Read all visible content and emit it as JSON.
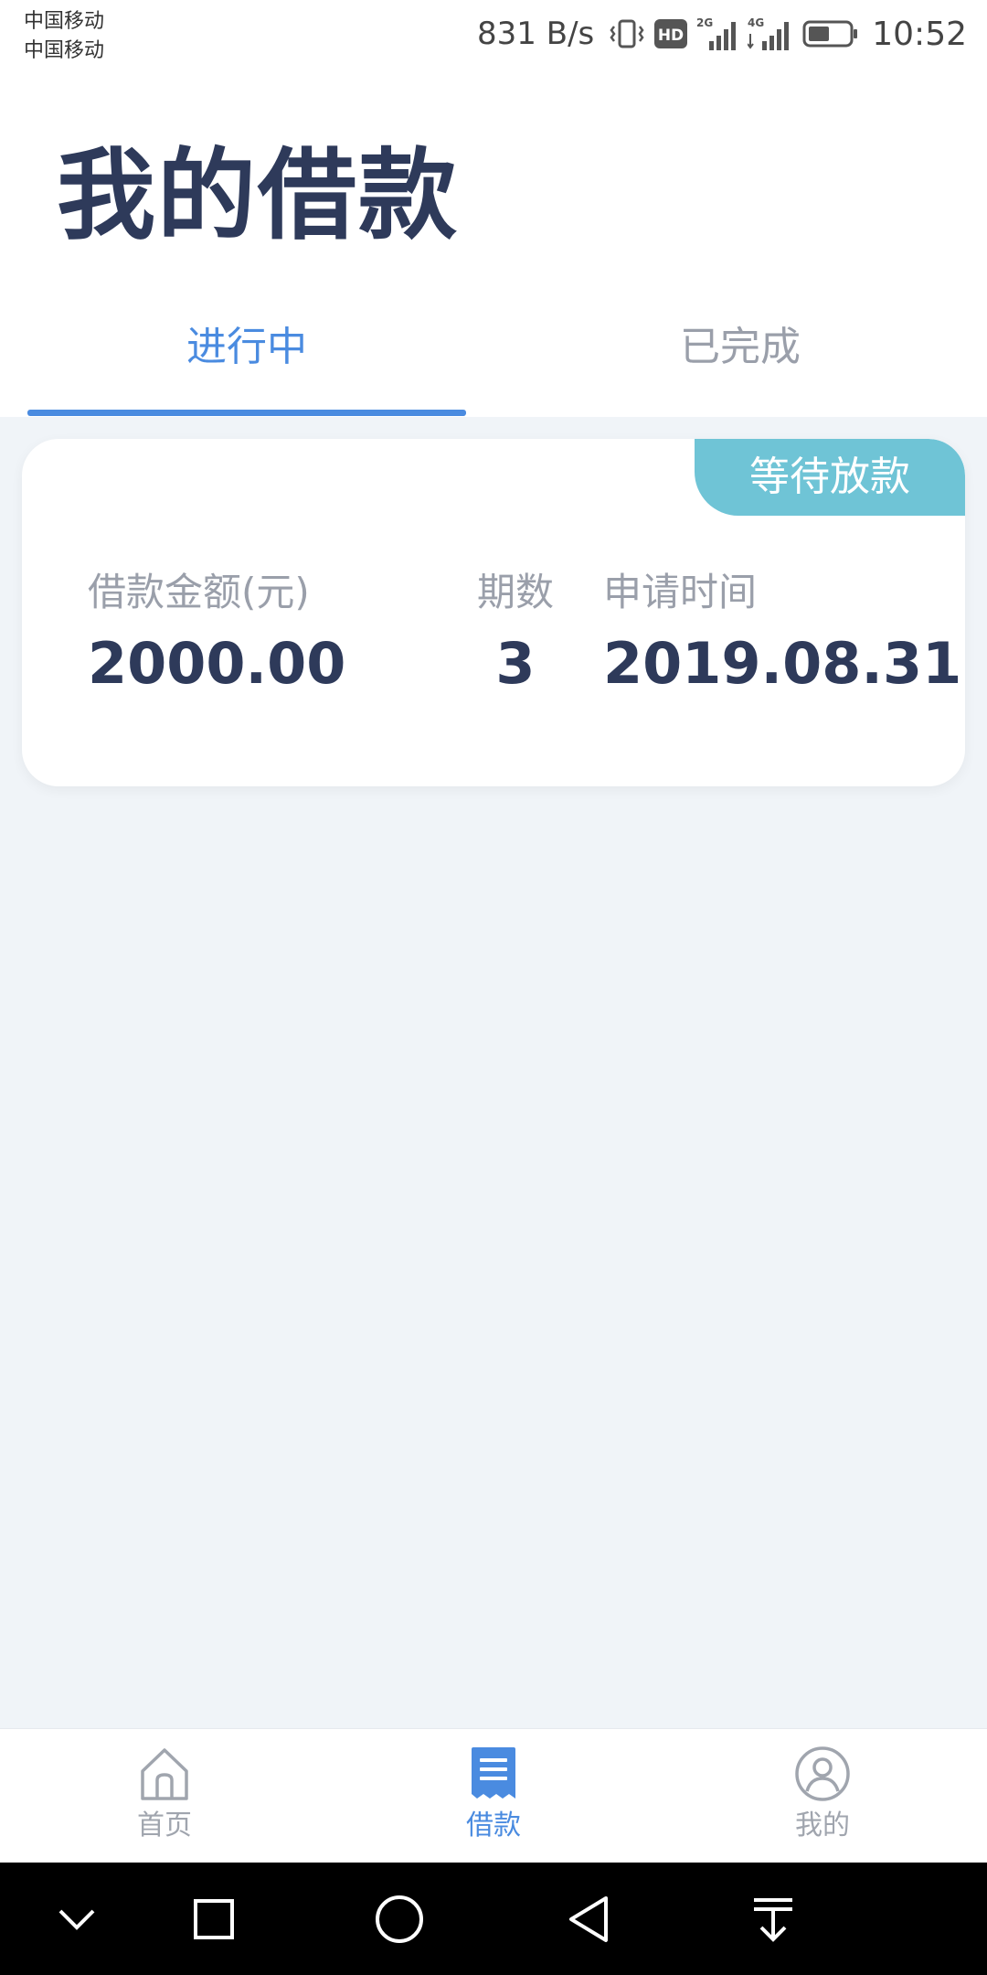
{
  "status_bar": {
    "carrier_1": "中国移动",
    "carrier_2": "中国移动",
    "net_speed": "831 B/s",
    "hd_label": "HD",
    "network_1": "2G",
    "network_2": "4G",
    "time": "10:52"
  },
  "header": {
    "title": "我的借款",
    "tabs": [
      {
        "label": "进行中",
        "active": true
      },
      {
        "label": "已完成",
        "active": false
      }
    ]
  },
  "loan_card": {
    "status": "等待放款",
    "amount_label": "借款金额(元)",
    "amount_value": "2000.00",
    "periods_label": "期数",
    "periods_value": "3",
    "date_label": "申请时间",
    "date_value": "2019.08.31"
  },
  "bottom_nav": {
    "items": [
      {
        "label": "首页",
        "icon": "home-icon",
        "active": false
      },
      {
        "label": "借款",
        "icon": "loan-document-icon",
        "active": true
      },
      {
        "label": "我的",
        "icon": "user-icon",
        "active": false
      }
    ]
  },
  "colors": {
    "accent": "#4a8be0",
    "title": "#2e3a5a",
    "badge": "#6fc4d6",
    "muted": "#9a9faa",
    "background": "#f0f4f8"
  },
  "system_nav": {
    "icons": [
      "collapse-icon",
      "recent-apps-icon",
      "home-circle-icon",
      "back-icon",
      "notification-pull-icon"
    ]
  }
}
